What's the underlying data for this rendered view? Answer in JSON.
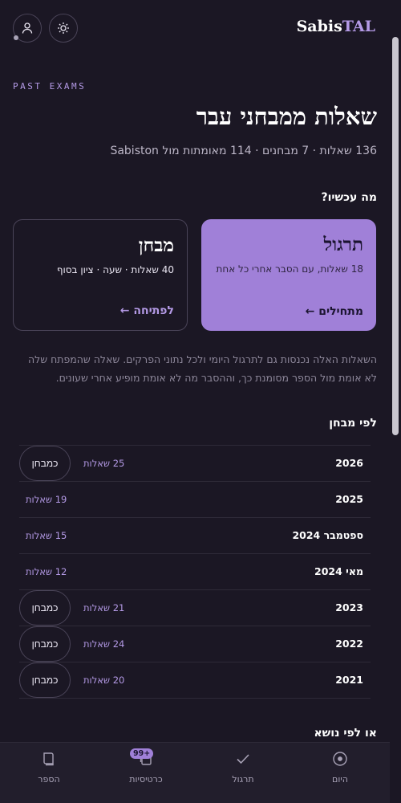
{
  "header": {
    "logo_part1": "Sabis",
    "logo_part2": "TAL"
  },
  "eyebrow": "PAST EXAMS",
  "title": "שאלות ממבחני עבר",
  "subtitle": "136 שאלות · 7 מבחנים · 114 מאומתות מול Sabiston",
  "section_question": "מה עכשיו?",
  "cards": {
    "practice": {
      "title": "תרגול",
      "desc": "18 שאלות, עם הסבר אחרי כל אחת",
      "cta": "מתחילים ←"
    },
    "exam": {
      "title": "מבחן",
      "desc": "40 שאלות · שעה · ציון בסוף",
      "cta": "לפתיחה ←"
    }
  },
  "note": "השאלות האלה נכנסות גם לתרגול היומי ולכל נתוני הפרקים. שאלה שהמפתח שלה לא אומת מול הספר מסומנת כך, וההסבר מה לא אומת מופיע אחרי שעונים.",
  "section_by_exam": "לפי מבחן",
  "exams": [
    {
      "year": "2026",
      "count": "25 שאלות",
      "button": "כמבחן"
    },
    {
      "year": "2025",
      "count": "19 שאלות",
      "button": ""
    },
    {
      "year": "ספטמבר 2024",
      "count": "15 שאלות",
      "button": ""
    },
    {
      "year": "מאי 2024",
      "count": "12 שאלות",
      "button": ""
    },
    {
      "year": "2023",
      "count": "21 שאלות",
      "button": "כמבחן"
    },
    {
      "year": "2022",
      "count": "24 שאלות",
      "button": "כמבחן"
    },
    {
      "year": "2021",
      "count": "20 שאלות",
      "button": "כמבחן"
    }
  ],
  "section_by_topic": "או לפי נושא",
  "nav": {
    "today": "היום",
    "practice": "תרגול",
    "cards": "כרטיסיות",
    "cards_badge": "99+",
    "book": "הספר"
  },
  "icons": {
    "user": "user-icon",
    "theme": "sun-icon",
    "today": "target-icon",
    "practice": "check-icon",
    "cards": "cards-icon",
    "book": "book-icon"
  },
  "colors": {
    "background": "#1b1724",
    "accent": "#b49ae6",
    "practice_card": "#a080d8"
  }
}
